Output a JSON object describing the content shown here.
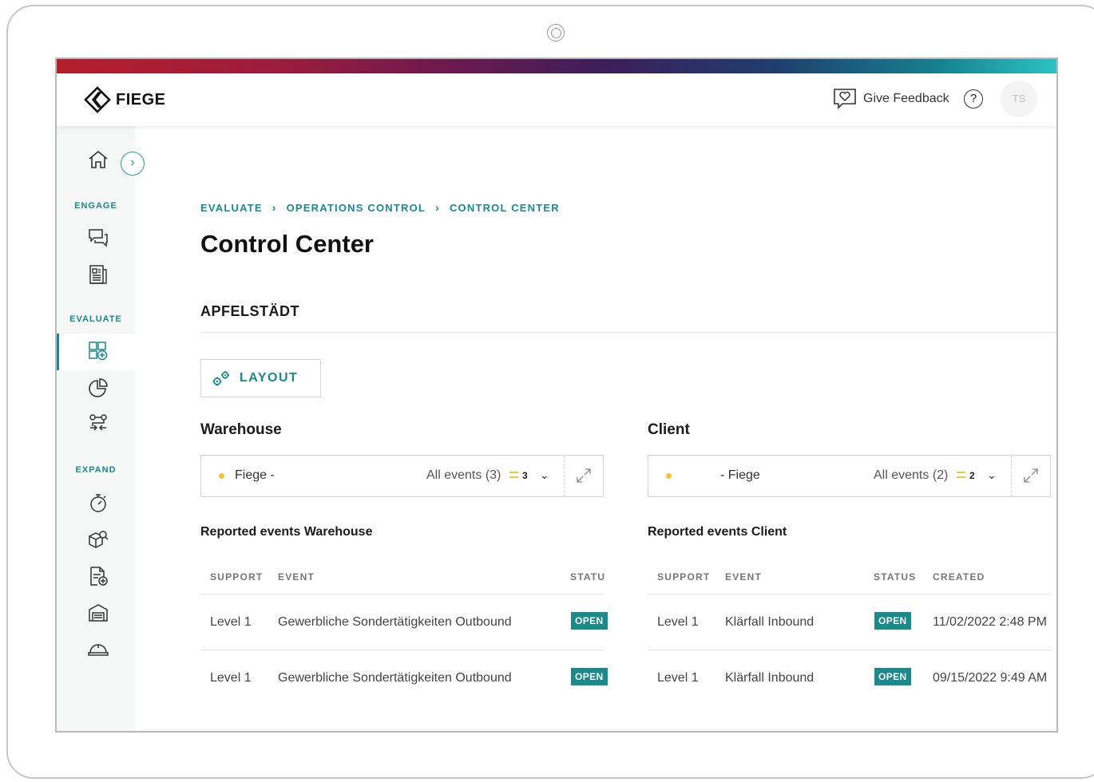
{
  "header": {
    "brand": "FIEGE",
    "feedback_label": "Give Feedback",
    "help_glyph": "?",
    "avatar_initials": "TS"
  },
  "sidebar": {
    "sections": [
      {
        "label": "ENGAGE"
      },
      {
        "label": "EVALUATE"
      },
      {
        "label": "EXPAND"
      }
    ],
    "expand_glyph": "›"
  },
  "breadcrumb": [
    "EVALUATE",
    "OPERATIONS CONTROL",
    "CONTROL CENTER"
  ],
  "page_title": "Control Center",
  "section_title": "APFELSTÄDT",
  "layout_button": "LAYOUT",
  "panels": {
    "warehouse": {
      "title": "Warehouse",
      "selector_name": "Fiege -",
      "events_label": "All events (3)",
      "count": "3",
      "reported_title": "Reported events Warehouse",
      "columns": [
        "SUPPORT",
        "EVENT",
        "STATU"
      ],
      "rows": [
        {
          "support": "Level 1",
          "event": "Gewerbliche Sondertätigkeiten Outbound",
          "status": "OPEN"
        },
        {
          "support": "Level 1",
          "event": "Gewerbliche Sondertätigkeiten Outbound",
          "status": "OPEN"
        }
      ]
    },
    "client": {
      "title": "Client",
      "selector_name": "- Fiege",
      "events_label": "All events (2)",
      "count": "2",
      "reported_title": "Reported events Client",
      "columns": [
        "SUPPORT",
        "EVENT",
        "STATUS",
        "CREATED"
      ],
      "rows": [
        {
          "support": "Level 1",
          "event": "Klärfall Inbound",
          "status": "OPEN",
          "created": "11/02/2022 2:48 PM"
        },
        {
          "support": "Level 1",
          "event": "Klärfall Inbound",
          "status": "OPEN",
          "created": "09/15/2022 9:49 AM"
        }
      ]
    }
  },
  "colors": {
    "accent": "#1a8a8c",
    "status_dot": "#f4c430",
    "badge": "#1a8a8c"
  }
}
